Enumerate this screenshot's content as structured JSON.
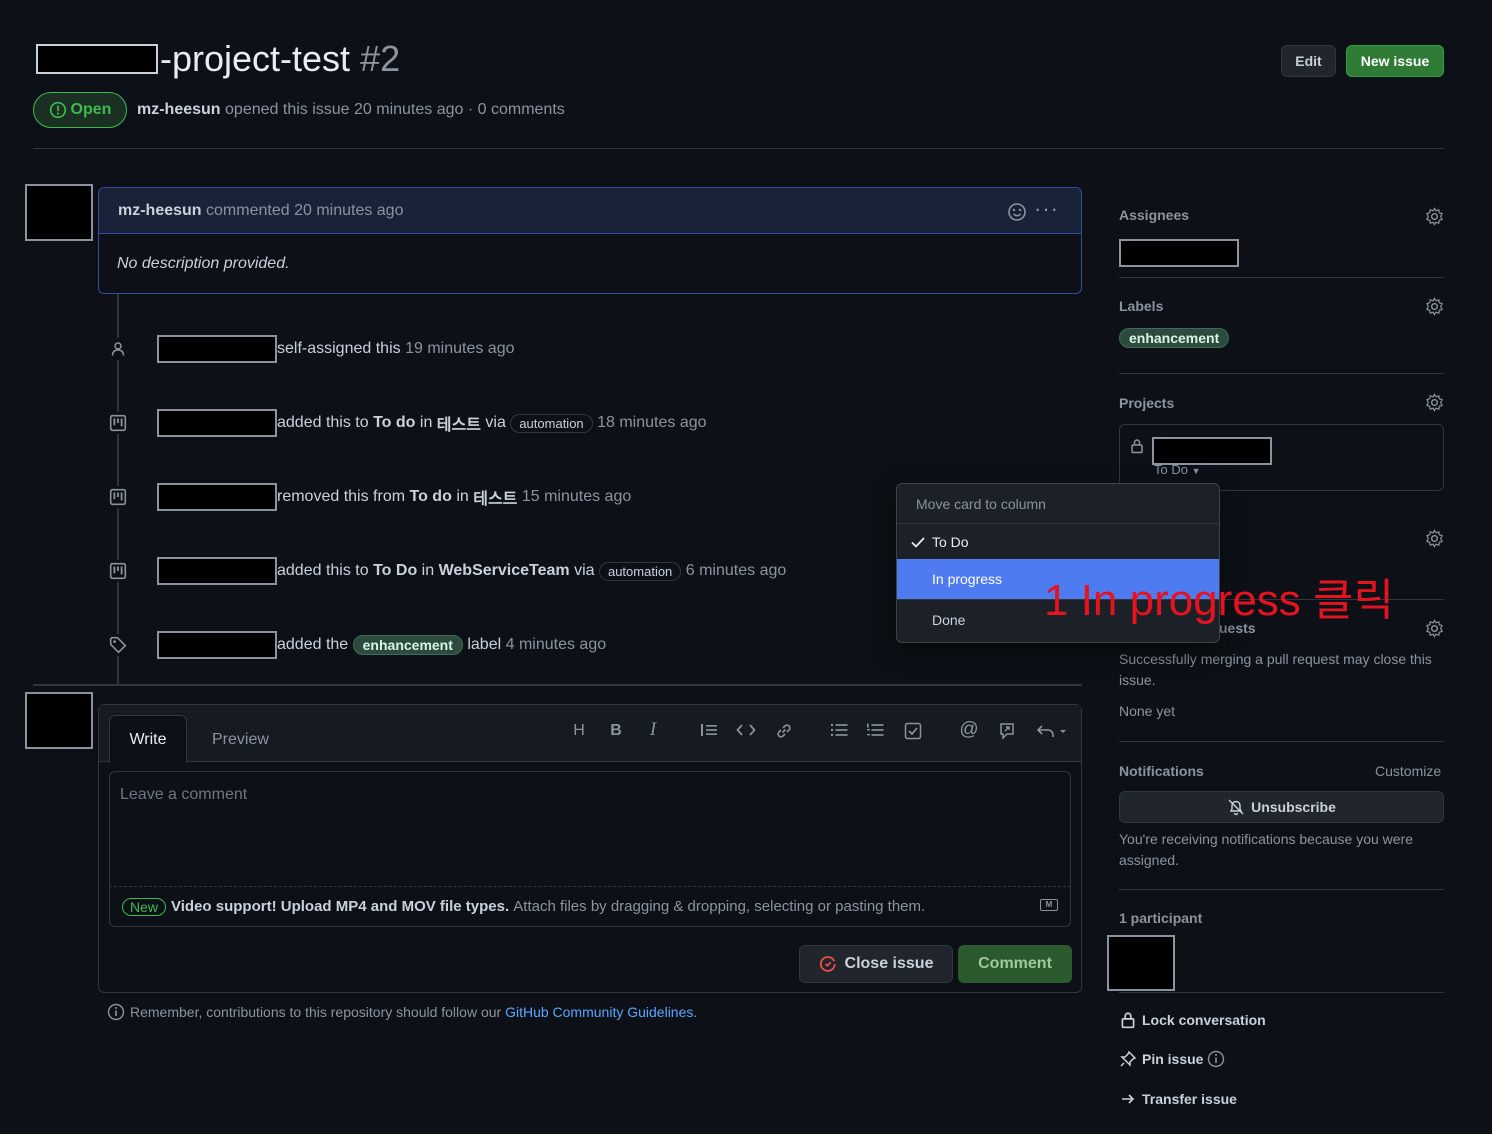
{
  "header": {
    "title_text": "-project-test",
    "issue_number": "#2",
    "edit_label": "Edit",
    "new_issue_label": "New issue",
    "state_label": "Open",
    "author": "mz-heesun",
    "meta_text": "opened this issue 20 minutes ago · 0 comments"
  },
  "comment": {
    "author": "mz-heesun",
    "meta": "commented 20 minutes ago",
    "body": "No description provided."
  },
  "timeline": [
    {
      "parts": [
        "self-assigned this",
        "19 minutes ago"
      ]
    },
    {
      "parts": [
        "added this to",
        "To do",
        "in",
        "테스트",
        "via",
        "automation",
        "18 minutes ago"
      ]
    },
    {
      "parts": [
        "removed this from",
        "To do",
        "in",
        "테스트",
        "15 minutes ago"
      ]
    },
    {
      "parts": [
        "added this to",
        "To Do",
        "in",
        "WebServiceTeam",
        "via",
        "automation",
        "6 minutes ago"
      ]
    },
    {
      "parts": [
        "added the",
        "enhancement",
        "label",
        "4 minutes ago"
      ]
    }
  ],
  "editor": {
    "tab_write": "Write",
    "tab_preview": "Preview",
    "placeholder": "Leave a comment",
    "new_badge": "New",
    "upload_bold": "Video support! Upload MP4 and MOV file types.",
    "upload_rest": "Attach files by dragging & dropping, selecting or pasting them.",
    "close_issue_label": "Close issue",
    "comment_label": "Comment",
    "toolbar": {
      "heading": "H",
      "bold": "B",
      "italic": "I"
    }
  },
  "footer_note": {
    "text": "Remember, contributions to this repository should follow our",
    "link": "GitHub Community Guidelines",
    "period": "."
  },
  "sidebar": {
    "assignees_title": "Assignees",
    "labels_title": "Labels",
    "label_enhancement": "enhancement",
    "projects_title": "Projects",
    "project_column": "To Do",
    "dev_title_fragment": "uests",
    "dev_desc": "Successfully merging a pull request may close this issue.",
    "dev_none": "None yet",
    "notifications_title": "Notifications",
    "customize_label": "Customize",
    "unsubscribe_label": "Unsubscribe",
    "notif_desc": "You're receiving notifications because you were assigned.",
    "participants_title": "1 participant",
    "lock_label": "Lock conversation",
    "pin_label": "Pin issue",
    "transfer_label": "Transfer issue"
  },
  "dropdown": {
    "header": "Move card to column",
    "items": [
      "To Do",
      "In progress",
      "Done"
    ],
    "checked_index": 0,
    "highlighted_index": 1
  },
  "annotation": {
    "text": "1 In progress 클릭",
    "color": "#e5131f"
  },
  "colors": {
    "background": "#0d1117",
    "open_green": "#3fb950",
    "accent_blue": "#4f7bf0",
    "link_blue": "#58a6ff",
    "close_red": "#f85149"
  }
}
